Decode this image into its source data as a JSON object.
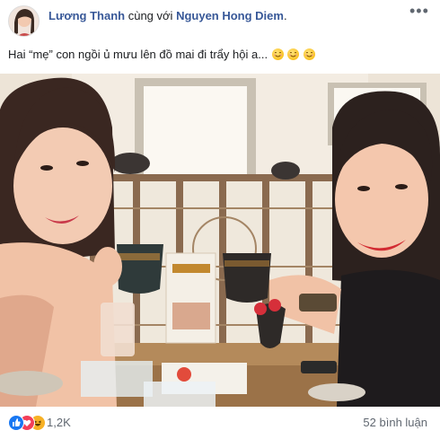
{
  "post": {
    "author": "Lương Thanh",
    "with_text": "cùng với",
    "tagged": "Nguyen Hong Diem",
    "tagged_suffix": ".",
    "caption": "Hai “mẹ” con ngồi ủ mưu lên đồ mai đi trẩy hội a...",
    "caption_emojis": [
      "smiling-face",
      "smiling-face",
      "smiling-face"
    ],
    "more_label": "•••"
  },
  "footer": {
    "reactions": [
      "like-reaction-icon",
      "love-reaction-icon",
      "haha-reaction-icon"
    ],
    "reaction_count": "1,2K",
    "comment_count": "52 bình luận"
  },
  "colors": {
    "link": "#385898",
    "secondary_text": "#606770",
    "like": "#1877f2",
    "love": "#f33e58",
    "haha": "#f7b125"
  }
}
